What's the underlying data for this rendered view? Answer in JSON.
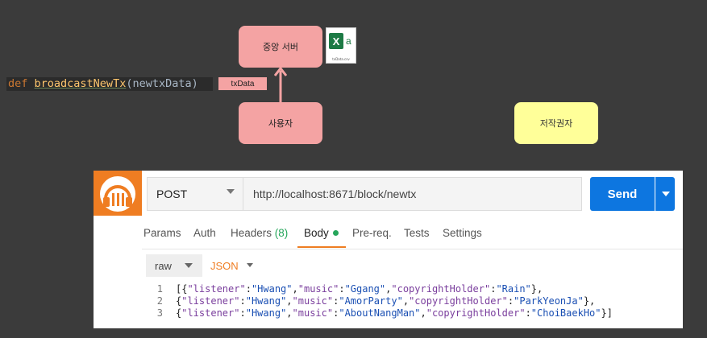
{
  "diagram": {
    "server_label": "중앙 서버",
    "user_label": "사용자",
    "copyright_label": "저작권자",
    "txdata_label": "txData",
    "excel_file_name": "txData.csv",
    "excel_icon_letter": "X",
    "excel_icon_sub": "a",
    "code": {
      "keyword": "def",
      "function_name": "broadcastNewTx",
      "open_paren": "(",
      "param": "newtxData",
      "close_paren": ")"
    }
  },
  "postman": {
    "method": "POST",
    "url": "http://localhost:8671/block/newtx",
    "send_label": "Send",
    "tabs": {
      "params": "Params",
      "auth": "Auth",
      "headers": "Headers",
      "headers_count": "(8)",
      "body": "Body",
      "prereq": "Pre-req.",
      "tests": "Tests",
      "settings": "Settings"
    },
    "body_mode": "raw",
    "body_format": "JSON",
    "code_lines": [
      {
        "num": "1",
        "open": "[{",
        "k1": "\"listener\"",
        "v1": "\"Hwang\"",
        "k2": "\"music\"",
        "v2": "\"Ggang\"",
        "k3": "\"copyrightHolder\"",
        "v3": "\"Rain\"",
        "close": "},"
      },
      {
        "num": "2",
        "open": "{",
        "k1": "\"listener\"",
        "v1": "\"Hwang\"",
        "k2": "\"music\"",
        "v2": "\"AmorParty\"",
        "k3": "\"copyrightHolder\"",
        "v3": "\"ParkYeonJa\"",
        "close": "},"
      },
      {
        "num": "3",
        "open": "{",
        "k1": "\"listener\"",
        "v1": "\"Hwang\"",
        "k2": "\"music\"",
        "v2": "\"AboutNangMan\"",
        "k3": "\"copyrightHolder\"",
        "v3": "\"ChoiBaekHo\"",
        "close": "}]"
      }
    ]
  },
  "colors": {
    "background": "#3b3b3b",
    "pink_box": "#f4a3a3",
    "yellow_box": "#ffff99",
    "postman_orange": "#ef7d22",
    "send_blue": "#0d76e0",
    "status_green": "#26a65b"
  }
}
